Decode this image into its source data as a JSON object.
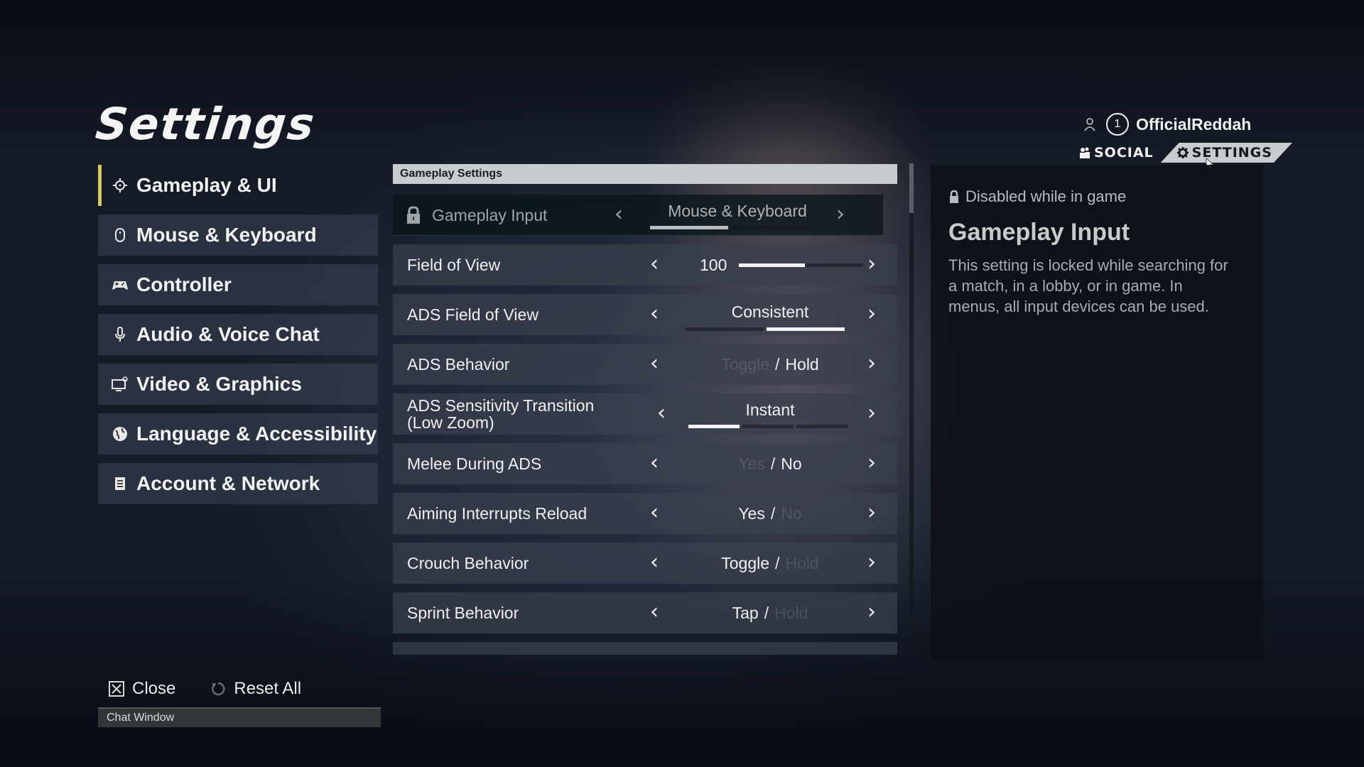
{
  "page_title": "Settings",
  "user": {
    "party_count": "1",
    "username": "OfficialReddah"
  },
  "top_tabs": [
    {
      "label": "SOCIAL",
      "icon": "people-icon",
      "active": false
    },
    {
      "label": "SETTINGS",
      "icon": "gear-icon",
      "active": true
    }
  ],
  "sidebar": {
    "items": [
      {
        "label": "Gameplay & UI",
        "icon": "crosshair-icon",
        "active": true
      },
      {
        "label": "Mouse & Keyboard",
        "icon": "mouse-icon",
        "active": false
      },
      {
        "label": "Controller",
        "icon": "gamepad-icon",
        "active": false
      },
      {
        "label": "Audio & Voice Chat",
        "icon": "microphone-icon",
        "active": false
      },
      {
        "label": "Video & Graphics",
        "icon": "monitor-icon",
        "active": false
      },
      {
        "label": "Language & Accessibility",
        "icon": "globe-icon",
        "active": false
      },
      {
        "label": "Account & Network",
        "icon": "document-icon",
        "active": false
      }
    ]
  },
  "panel": {
    "header": "Gameplay Settings",
    "rows": [
      {
        "label": "Gameplay Input",
        "value": "Mouse & Keyboard",
        "locked": true,
        "option_index": 1,
        "option_count": 2
      },
      {
        "label": "Field of View",
        "value": "100",
        "type": "slider",
        "slider_fraction": 0.53
      },
      {
        "label": "ADS Field of View",
        "value": "Consistent",
        "type": "options",
        "option_index": 2,
        "option_count": 2
      },
      {
        "label": "ADS Behavior",
        "type": "toggle",
        "option_a": "Toggle",
        "option_b": "Hold",
        "selected": "Hold"
      },
      {
        "label_line1": "ADS Sensitivity Transition",
        "label_line2": "(Low Zoom)",
        "value": "Instant",
        "type": "options",
        "option_index": 1,
        "option_count": 3
      },
      {
        "label": "Melee During ADS",
        "type": "toggle",
        "option_a": "Yes",
        "option_b": "No",
        "selected": "No"
      },
      {
        "label": "Aiming Interrupts Reload",
        "type": "toggle",
        "option_a": "Yes",
        "option_b": "No",
        "selected": "Yes"
      },
      {
        "label": "Crouch Behavior",
        "type": "toggle",
        "option_a": "Toggle",
        "option_b": "Hold",
        "selected": "Toggle"
      },
      {
        "label": "Sprint Behavior",
        "type": "toggle",
        "option_a": "Tap",
        "option_b": "Hold",
        "selected": "Tap"
      }
    ],
    "separator": "/",
    "arrow_left": "‹",
    "arrow_right": "›"
  },
  "info": {
    "lock_note": "Disabled while in game",
    "title": "Gameplay Input",
    "description": "This setting is locked while searching for a match, in a lobby, or in game. In menus, all input devices can be used."
  },
  "bottom": {
    "close_label": "Close",
    "reset_label": "Reset All",
    "chat_window_label": "Chat Window"
  }
}
